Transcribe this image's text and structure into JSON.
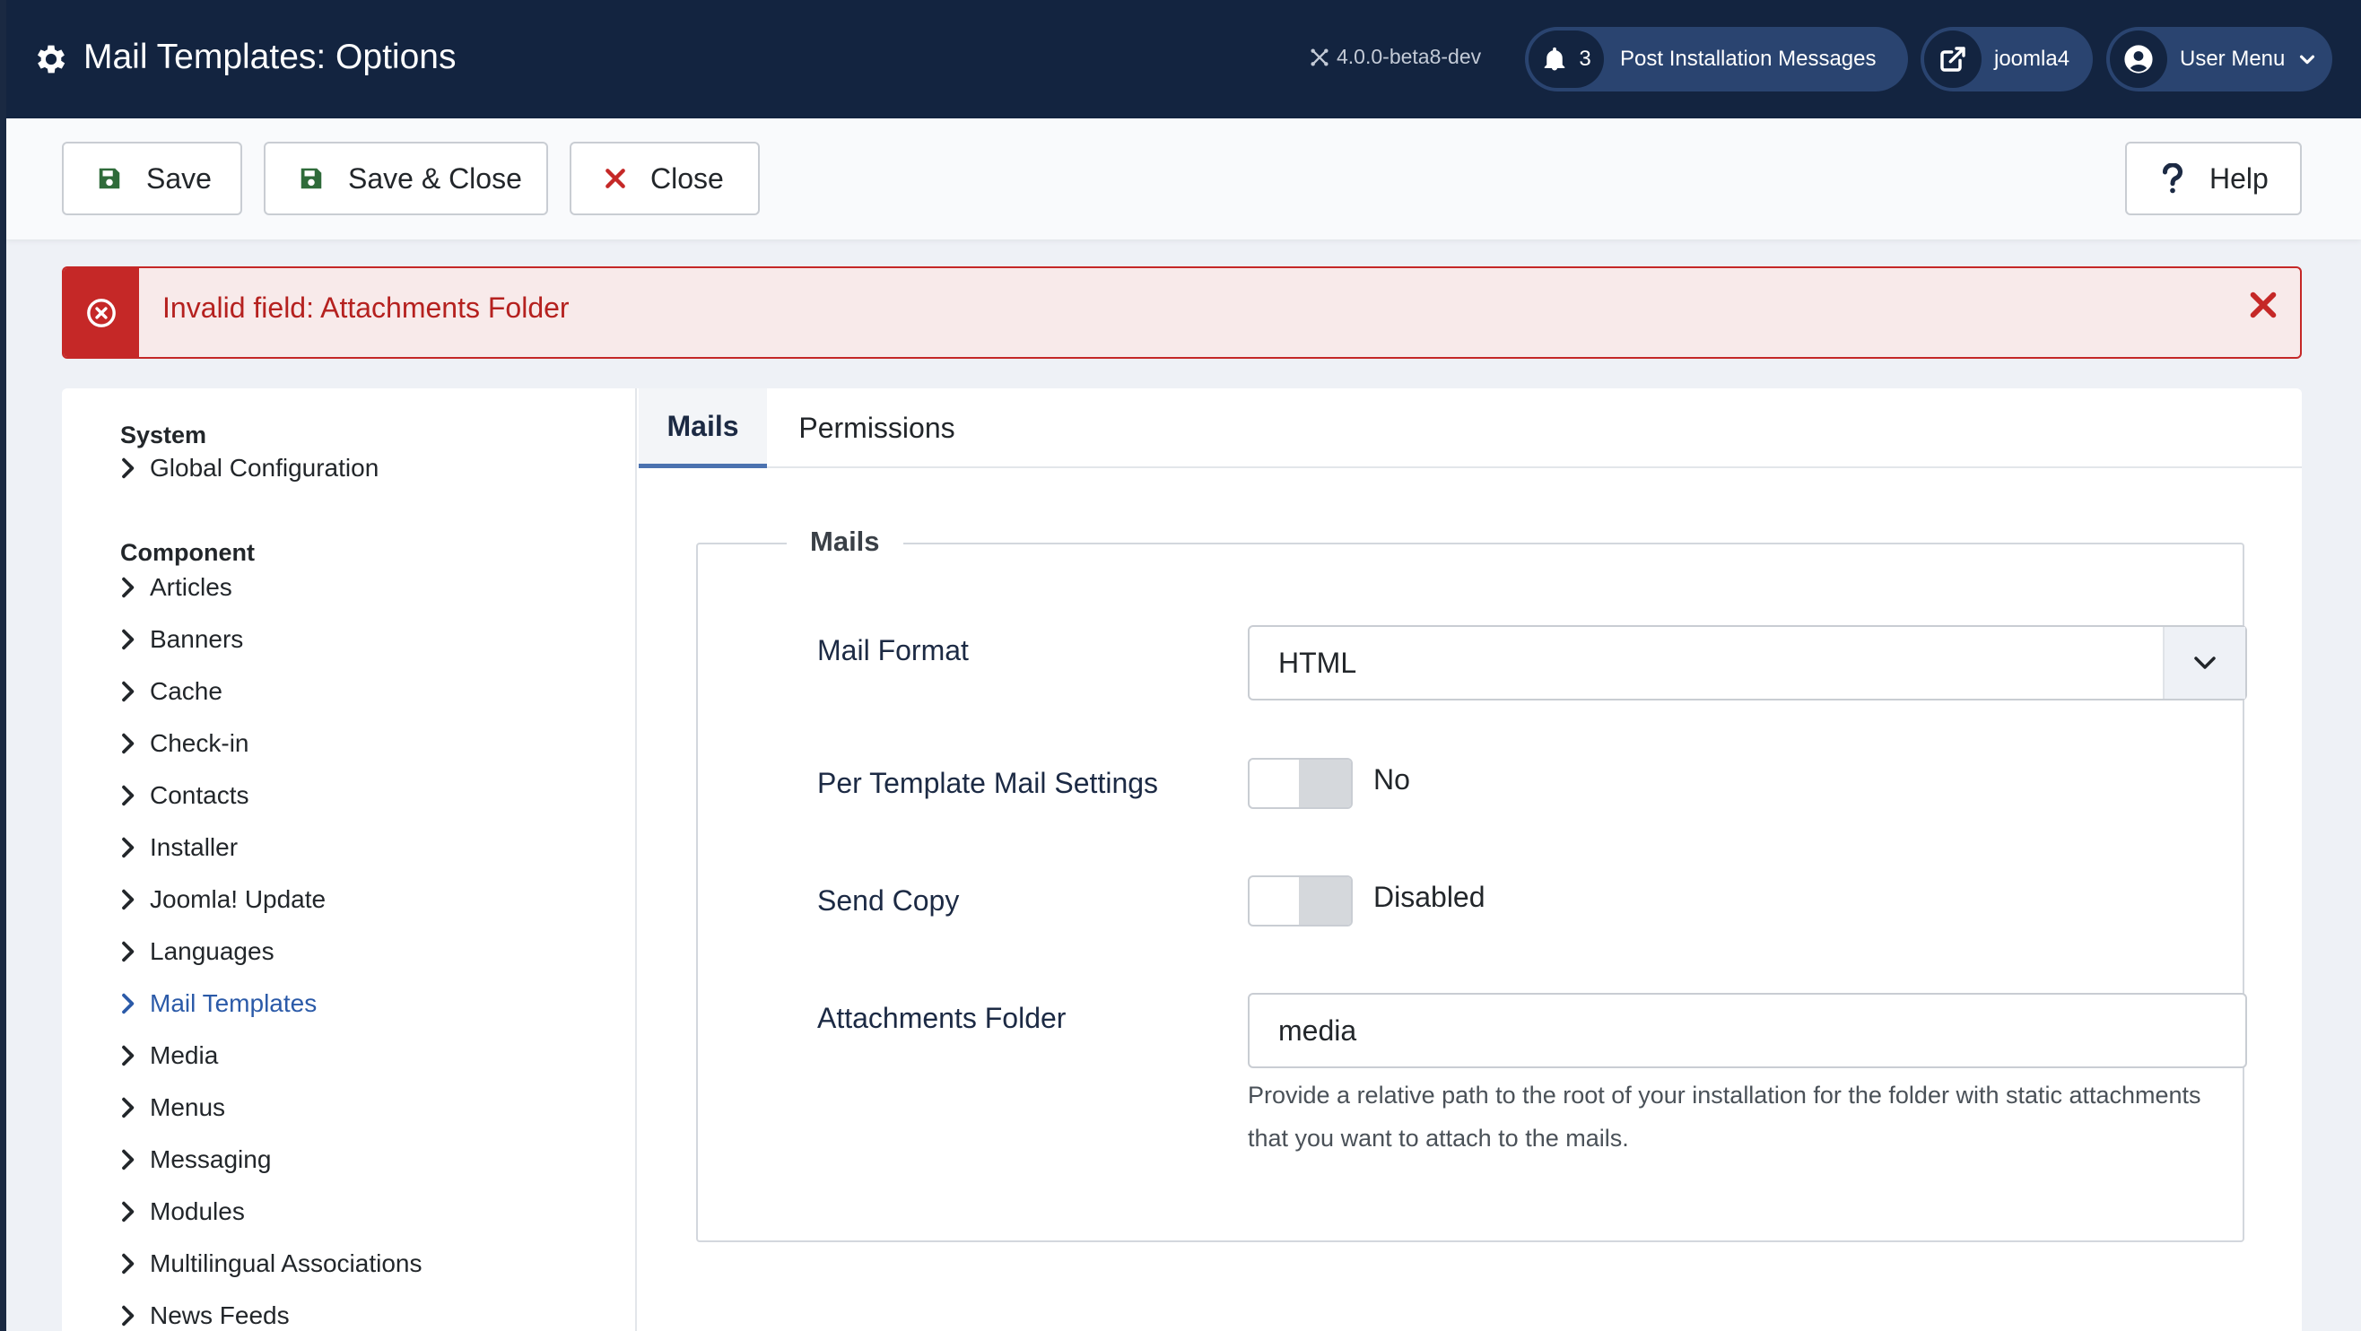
{
  "header": {
    "title": "Mail Templates: Options",
    "version": "4.0.0-beta8-dev",
    "notifications_count": "3",
    "post_install_label": "Post Installation Messages",
    "site_label": "joomla4",
    "user_menu_label": "User Menu"
  },
  "toolbar": {
    "save_label": "Save",
    "save_close_label": "Save & Close",
    "close_label": "Close",
    "help_label": "Help"
  },
  "alert": {
    "message": "Invalid field: Attachments Folder"
  },
  "sidebar": {
    "system_heading": "System",
    "system_items": [
      "Global Configuration"
    ],
    "component_heading": "Component",
    "component_items": [
      "Articles",
      "Banners",
      "Cache",
      "Check-in",
      "Contacts",
      "Installer",
      "Joomla! Update",
      "Languages",
      "Mail Templates",
      "Media",
      "Menus",
      "Messaging",
      "Modules",
      "Multilingual Associations",
      "News Feeds"
    ],
    "active_item": "Mail Templates"
  },
  "tabs": {
    "mails": "Mails",
    "permissions": "Permissions"
  },
  "form": {
    "legend": "Mails",
    "mail_format_label": "Mail Format",
    "mail_format_value": "HTML",
    "per_template_label": "Per Template Mail Settings",
    "per_template_value": "No",
    "send_copy_label": "Send Copy",
    "send_copy_value": "Disabled",
    "attachments_label": "Attachments Folder",
    "attachments_value": "media",
    "attachments_help": "Provide a relative path to the root of your installation for the folder with static attachments that you want to attach to the mails."
  },
  "colors": {
    "header_bg": "#132440",
    "pill_bg": "#2a4470",
    "alert_red": "#c52827",
    "active_link": "#2b5aa8",
    "save_green": "#2f6b3a",
    "close_red": "#c52827"
  },
  "icons": {
    "header": "gear-icon",
    "version": "joomla-logo-icon",
    "notifications": "bell-icon",
    "site": "external-link-icon",
    "user": "user-circle-icon",
    "save": "floppy-disk-icon",
    "close": "x-icon",
    "help": "question-icon",
    "alert": "x-circle-icon",
    "nav": "chevron-right-icon",
    "select": "chevron-down-icon"
  }
}
